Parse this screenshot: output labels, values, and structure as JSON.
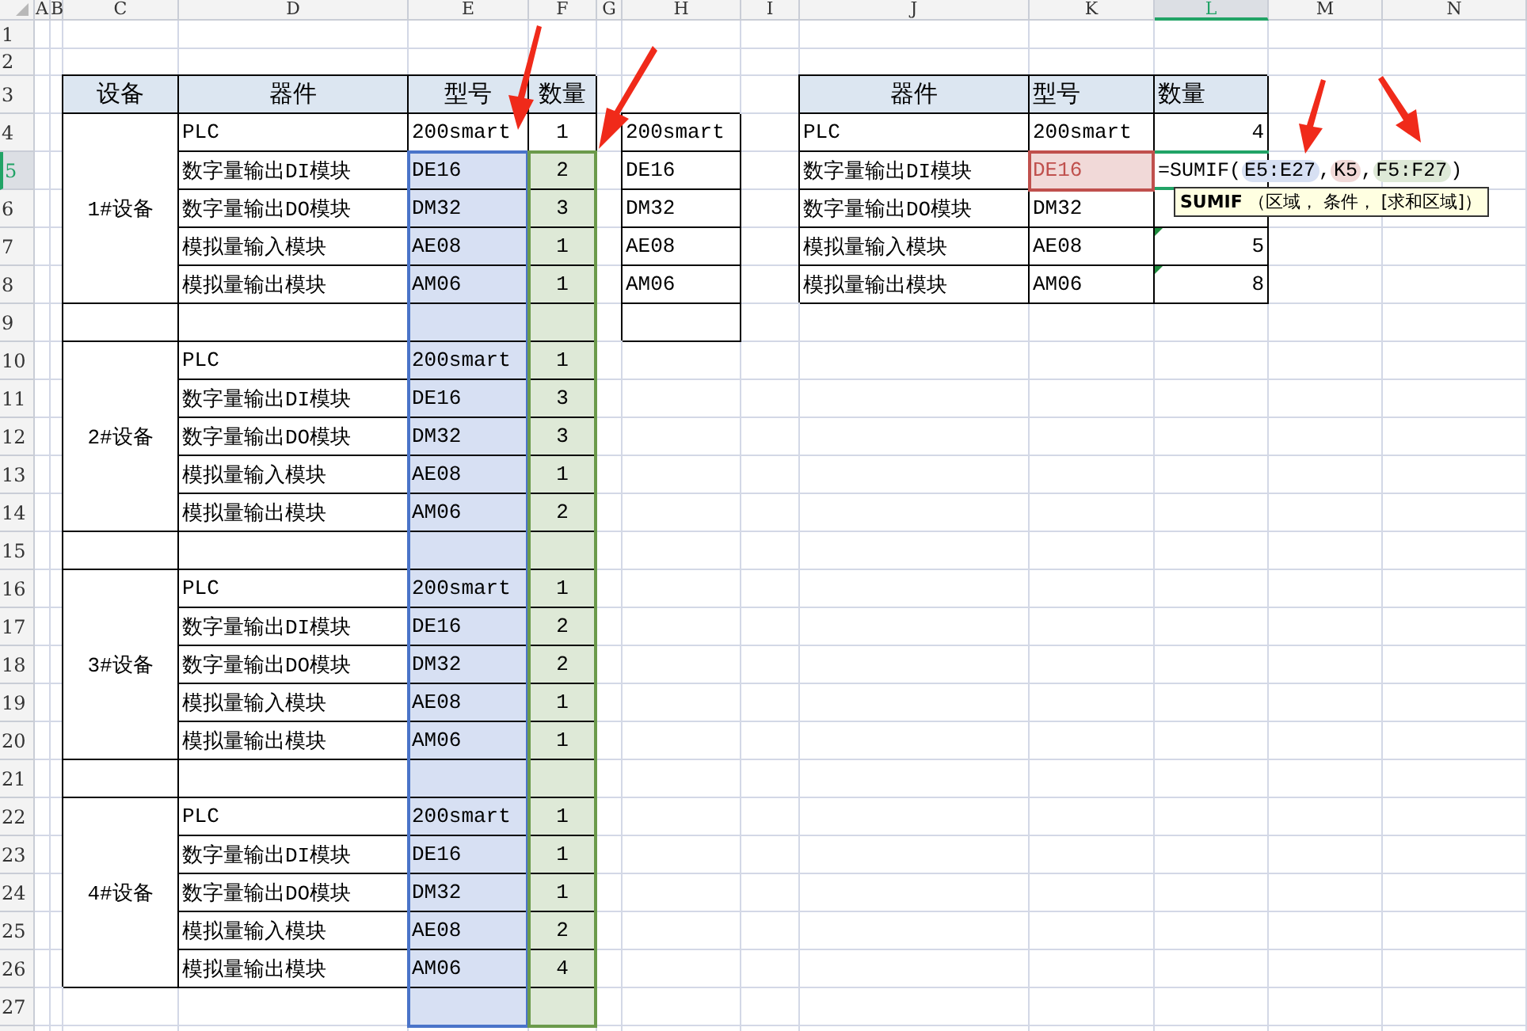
{
  "column_headers": [
    {
      "label": "A",
      "selected": false
    },
    {
      "label": "B",
      "selected": false
    },
    {
      "label": "C",
      "selected": false
    },
    {
      "label": "D",
      "selected": false
    },
    {
      "label": "E",
      "selected": false
    },
    {
      "label": "F",
      "selected": false
    },
    {
      "label": "G",
      "selected": false
    },
    {
      "label": "H",
      "selected": false
    },
    {
      "label": "I",
      "selected": false
    },
    {
      "label": "J",
      "selected": false
    },
    {
      "label": "K",
      "selected": false
    },
    {
      "label": "L",
      "selected": true
    },
    {
      "label": "M",
      "selected": false
    },
    {
      "label": "N",
      "selected": false
    }
  ],
  "row_headers": [
    {
      "label": "1",
      "selected": false
    },
    {
      "label": "2",
      "selected": false
    },
    {
      "label": "3",
      "selected": false
    },
    {
      "label": "4",
      "selected": false
    },
    {
      "label": "5",
      "selected": true
    },
    {
      "label": "6",
      "selected": false
    },
    {
      "label": "7",
      "selected": false
    },
    {
      "label": "8",
      "selected": false
    },
    {
      "label": "9",
      "selected": false
    },
    {
      "label": "10",
      "selected": false
    },
    {
      "label": "11",
      "selected": false
    },
    {
      "label": "12",
      "selected": false
    },
    {
      "label": "13",
      "selected": false
    },
    {
      "label": "14",
      "selected": false
    },
    {
      "label": "15",
      "selected": false
    },
    {
      "label": "16",
      "selected": false
    },
    {
      "label": "17",
      "selected": false
    },
    {
      "label": "18",
      "selected": false
    },
    {
      "label": "19",
      "selected": false
    },
    {
      "label": "20",
      "selected": false
    },
    {
      "label": "21",
      "selected": false
    },
    {
      "label": "22",
      "selected": false
    },
    {
      "label": "23",
      "selected": false
    },
    {
      "label": "24",
      "selected": false
    },
    {
      "label": "25",
      "selected": false
    },
    {
      "label": "26",
      "selected": false
    },
    {
      "label": "27",
      "selected": false
    }
  ],
  "left_table": {
    "headers": [
      "设备",
      "器件",
      "型号",
      "数量"
    ],
    "groups": [
      {
        "device": "1#设备",
        "items": [
          {
            "part": "PLC",
            "model": "200smart",
            "quantity": "1"
          },
          {
            "part": "数字量输出DI模块",
            "model": "DE16",
            "quantity": "2"
          },
          {
            "part": "数字量输出DO模块",
            "model": "DM32",
            "quantity": "3"
          },
          {
            "part": "模拟量输入模块",
            "model": "AE08",
            "quantity": "1"
          },
          {
            "part": "模拟量输出模块",
            "model": "AM06",
            "quantity": "1"
          }
        ]
      },
      {
        "device": "2#设备",
        "items": [
          {
            "part": "PLC",
            "model": "200smart",
            "quantity": "1"
          },
          {
            "part": "数字量输出DI模块",
            "model": "DE16",
            "quantity": "3"
          },
          {
            "part": "数字量输出DO模块",
            "model": "DM32",
            "quantity": "3"
          },
          {
            "part": "模拟量输入模块",
            "model": "AE08",
            "quantity": "1"
          },
          {
            "part": "模拟量输出模块",
            "model": "AM06",
            "quantity": "2"
          }
        ]
      },
      {
        "device": "3#设备",
        "items": [
          {
            "part": "PLC",
            "model": "200smart",
            "quantity": "1"
          },
          {
            "part": "数字量输出DI模块",
            "model": "DE16",
            "quantity": "2"
          },
          {
            "part": "数字量输出DO模块",
            "model": "DM32",
            "quantity": "2"
          },
          {
            "part": "模拟量输入模块",
            "model": "AE08",
            "quantity": "1"
          },
          {
            "part": "模拟量输出模块",
            "model": "AM06",
            "quantity": "1"
          }
        ]
      },
      {
        "device": "4#设备",
        "items": [
          {
            "part": "PLC",
            "model": "200smart",
            "quantity": "1"
          },
          {
            "part": "数字量输出DI模块",
            "model": "DE16",
            "quantity": "1"
          },
          {
            "part": "数字量输出DO模块",
            "model": "DM32",
            "quantity": "1"
          },
          {
            "part": "模拟量输入模块",
            "model": "AE08",
            "quantity": "2"
          },
          {
            "part": "模拟量输出模块",
            "model": "AM06",
            "quantity": "4"
          }
        ]
      }
    ]
  },
  "lookup_list": [
    "200smart",
    "DE16",
    "DM32",
    "AE08",
    "AM06"
  ],
  "right_table": {
    "headers": [
      "器件",
      "型号",
      "数量"
    ],
    "rows": [
      {
        "part": "PLC",
        "model": "200smart",
        "kind": "value",
        "quantity": "4",
        "error_flag": false
      },
      {
        "part": "数字量输出DI模块",
        "model": "DE16",
        "kind": "formula",
        "error_flag": false
      },
      {
        "part": "数字量输出DO模块",
        "model": "DM32",
        "kind": "hidden",
        "error_flag": false
      },
      {
        "part": "模拟量输入模块",
        "model": "AE08",
        "kind": "value",
        "quantity": "5",
        "error_flag": true
      },
      {
        "part": "模拟量输出模块",
        "model": "AM06",
        "kind": "value",
        "quantity": "8",
        "error_flag": true
      }
    ]
  },
  "formula": [
    {
      "kind": "text",
      "text": "=SUMIF("
    },
    {
      "kind": "ref",
      "text": "E5:E27",
      "color": "#4a74c9"
    },
    {
      "kind": "text",
      "text": ","
    },
    {
      "kind": "ref",
      "text": "K5",
      "color": "#c0504d"
    },
    {
      "kind": "text",
      "text": ","
    },
    {
      "kind": "ref",
      "text": "F5:F27",
      "color": "#6b9a4b"
    },
    {
      "kind": "text",
      "text": ")"
    }
  ],
  "tooltip": "**SUMIF** （区域， 条件， [求和区域]）"
}
